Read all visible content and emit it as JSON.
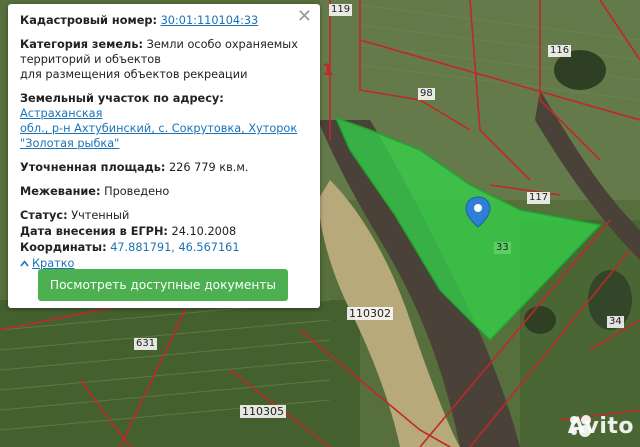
{
  "popup": {
    "cadastral_label": "Кадастровый номер:",
    "cadastral_value": "30:01:110104:33",
    "category_label": "Категория земель:",
    "category_value_1": "Земли особо охраняемых",
    "category_value_2": "территорий и объектов",
    "category_value_3": "для размещения объектов рекреации",
    "address_label": "Земельный участок по адресу:",
    "address_value_1": "Астраханская",
    "address_value_2": "обл., р-н Ахтубинский, с. Сокрутовка, Хуторок",
    "address_value_3": "\"Золотая рыбка\"",
    "area_label": "Уточненная площадь:",
    "area_value": "226 779 кв.м.",
    "survey_label": "Межевание:",
    "survey_value": "Проведено",
    "status_label": "Статус:",
    "status_value": "Учтенный",
    "date_label": "Дата внесения в ЕГРН:",
    "date_value": "24.10.2008",
    "coords_label": "Координаты:",
    "coords_value": "47.881791, 46.567161",
    "collapse_label": "Кратко",
    "documents_button": "Посмотреть доступные документы",
    "close_glyph": "✕"
  },
  "map": {
    "parcel_labels": [
      "119",
      "116",
      "98",
      "117",
      "33",
      "34",
      "631"
    ],
    "block_labels": [
      "110302",
      "110305"
    ],
    "red_label": "1",
    "watermark": "Avito",
    "colors": {
      "parcel_fill": "#33d64a",
      "boundary": "#c0282a",
      "river": "#4a4238",
      "field": "#4f6b36"
    }
  }
}
